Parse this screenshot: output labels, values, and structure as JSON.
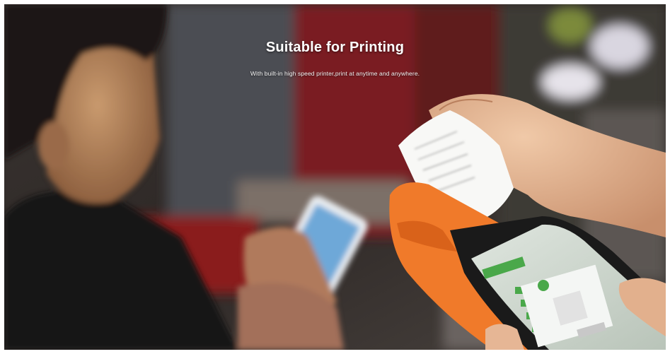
{
  "hero": {
    "title": "Suitable for Printing",
    "subtitle": "With built-in high speed printer,print at anytime and anywhere."
  },
  "colors": {
    "device_orange": "#f07a2a",
    "screen_green": "#4aa84a",
    "background_dark": "#2a2624",
    "curtain_red": "#7a1f22"
  },
  "icons": [
    "receipt-icon",
    "check-icon"
  ]
}
